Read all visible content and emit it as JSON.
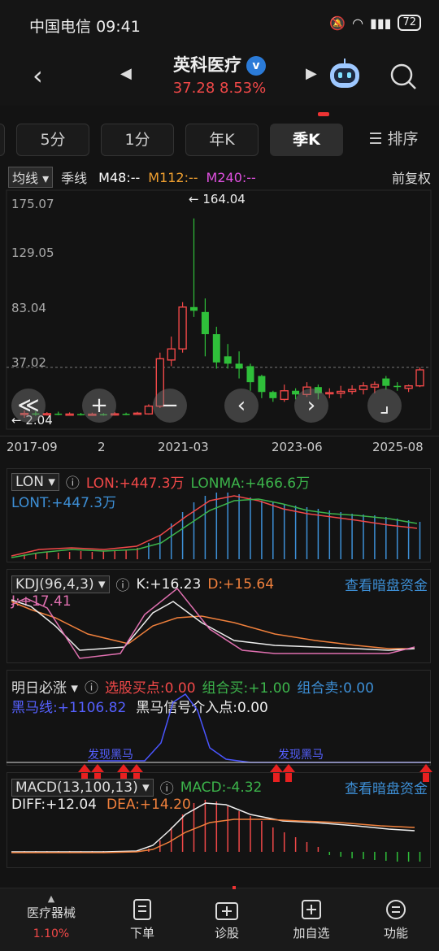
{
  "status": {
    "carrier": "中国电信",
    "time": "09:41",
    "battery": "72"
  },
  "header": {
    "title": "英科医疗",
    "price": "37.28",
    "change_pct": "8.53%",
    "v_badge": "v"
  },
  "tabs": [
    {
      "label": "5分"
    },
    {
      "label": "1分"
    },
    {
      "label": "年K"
    },
    {
      "label": "季K"
    },
    {
      "label": "排序"
    }
  ],
  "main_legend": {
    "mode": "均线",
    "period": "季线",
    "m48": "M48:--",
    "m112": "M112:--",
    "m240": "M240:--",
    "fq": "前复权"
  },
  "price_axis": [
    "175.07",
    "129.05",
    "83.04",
    "37.02"
  ],
  "high_marker": "164.04",
  "low_marker": "2.04",
  "date_axis": [
    "2017-09",
    "2",
    "2021-03",
    "2023-06",
    "2025-08"
  ],
  "overlay_controls": [
    "≪",
    "+",
    "−",
    "‹",
    "›",
    "⌟"
  ],
  "lon": {
    "name": "LON",
    "lon": "LON:+447.3万",
    "lonma": "LONMA:+466.6万",
    "lont": "LONT:+447.3万"
  },
  "kdj": {
    "name": "KDJ(96,4,3)",
    "k": "K:+16.23",
    "d": "D:+15.64",
    "j": "J:+17.41",
    "link": "查看暗盘资金"
  },
  "mrbz": {
    "name": "明日必涨",
    "buy_point": "选股买点:0.00",
    "combo_buy": "组合买:+1.00",
    "combo_sell": "组合卖:0.00",
    "black_horse": "黑马线:+1106.82",
    "signal": "黑马信号介入点:0.00",
    "tag1": "发现黑马",
    "tag2": "发现黑马"
  },
  "macd": {
    "name": "MACD(13,100,13)",
    "macd": "MACD:-4.32",
    "diff": "DIFF:+12.04",
    "dea": "DEA:+14.20",
    "link": "查看暗盘资金"
  },
  "bottom_nav": [
    {
      "label": "医疗器械",
      "sub": "1.10%"
    },
    {
      "label": "下单"
    },
    {
      "label": "诊股"
    },
    {
      "label": "加自选"
    },
    {
      "label": "功能"
    }
  ],
  "chart_data": {
    "type": "candlestick",
    "ylim": [
      2.04,
      175.07
    ],
    "candles": [
      {
        "o": 5.2,
        "c": 5.6,
        "h": 8.0,
        "l": 2.04
      },
      {
        "o": 5.6,
        "c": 4.8,
        "h": 7.4,
        "l": 3.6
      },
      {
        "o": 4.8,
        "c": 5.4,
        "h": 6.6,
        "l": 3.8
      },
      {
        "o": 5.4,
        "c": 4.9,
        "h": 7.0,
        "l": 4.1
      },
      {
        "o": 4.9,
        "c": 5.1,
        "h": 6.4,
        "l": 4.0
      },
      {
        "o": 5.1,
        "c": 4.7,
        "h": 6.0,
        "l": 3.9
      },
      {
        "o": 4.7,
        "c": 5.0,
        "h": 6.2,
        "l": 3.8
      },
      {
        "o": 5.0,
        "c": 4.6,
        "h": 5.8,
        "l": 3.7
      },
      {
        "o": 4.6,
        "c": 5.3,
        "h": 6.6,
        "l": 3.9
      },
      {
        "o": 5.3,
        "c": 5.0,
        "h": 6.2,
        "l": 4.2
      },
      {
        "o": 5.0,
        "c": 5.8,
        "h": 6.9,
        "l": 4.4
      },
      {
        "o": 5.2,
        "c": 11.5,
        "h": 13.0,
        "l": 4.6
      },
      {
        "o": 11.5,
        "c": 50.0,
        "h": 55.0,
        "l": 10.0
      },
      {
        "o": 49.0,
        "c": 58.0,
        "h": 68.0,
        "l": 44.0
      },
      {
        "o": 58.0,
        "c": 92.0,
        "h": 96.0,
        "l": 55.0
      },
      {
        "o": 92.0,
        "c": 89.0,
        "h": 164.04,
        "l": 84.0
      },
      {
        "o": 88.0,
        "c": 70.0,
        "h": 99.0,
        "l": 52.0
      },
      {
        "o": 70.0,
        "c": 47.0,
        "h": 76.0,
        "l": 42.0
      },
      {
        "o": 52.0,
        "c": 46.0,
        "h": 62.0,
        "l": 42.0
      },
      {
        "o": 46.0,
        "c": 42.0,
        "h": 56.0,
        "l": 34.0
      },
      {
        "o": 44.0,
        "c": 31.0,
        "h": 46.0,
        "l": 24.0
      },
      {
        "o": 36.0,
        "c": 23.0,
        "h": 37.0,
        "l": 18.0
      },
      {
        "o": 23.0,
        "c": 18.0,
        "h": 24.0,
        "l": 15.0
      },
      {
        "o": 17.0,
        "c": 24.0,
        "h": 29.0,
        "l": 15.0
      },
      {
        "o": 24.0,
        "c": 21.0,
        "h": 26.0,
        "l": 17.0
      },
      {
        "o": 21.0,
        "c": 27.0,
        "h": 31.0,
        "l": 19.0
      },
      {
        "o": 27.0,
        "c": 22.0,
        "h": 29.0,
        "l": 17.0
      },
      {
        "o": 22.0,
        "c": 22.5,
        "h": 26.0,
        "l": 18.0
      },
      {
        "o": 22.0,
        "c": 23.5,
        "h": 28.0,
        "l": 18.0
      },
      {
        "o": 23.5,
        "c": 25.0,
        "h": 28.5,
        "l": 21.0
      },
      {
        "o": 25.0,
        "c": 28.0,
        "h": 31.0,
        "l": 21.0
      },
      {
        "o": 27.0,
        "c": 29.0,
        "h": 31.5,
        "l": 22.0
      },
      {
        "o": 34.0,
        "c": 28.0,
        "h": 36.0,
        "l": 25.0
      },
      {
        "o": 28.0,
        "c": 27.0,
        "h": 31.0,
        "l": 24.0
      },
      {
        "o": 26.0,
        "c": 28.0,
        "h": 29.0,
        "l": 23.0
      },
      {
        "o": 28.0,
        "c": 41.0,
        "h": 43.0,
        "l": 27.0
      }
    ]
  }
}
